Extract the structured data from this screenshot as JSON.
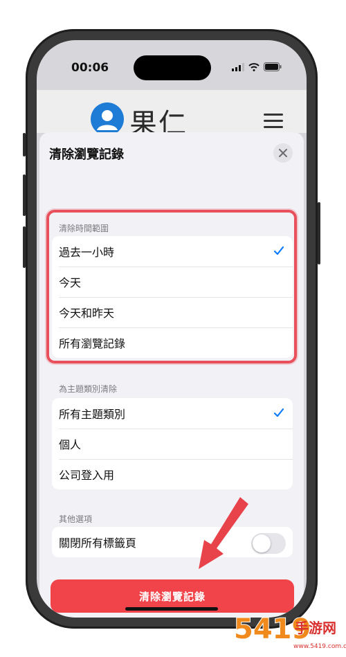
{
  "status_bar": {
    "time": "00:06"
  },
  "header": {
    "brand": "果仁"
  },
  "sheet": {
    "title": "清除瀏覽記錄",
    "time_range": {
      "header": "清除時間範圍",
      "options": [
        {
          "label": "過去一小時",
          "selected": true
        },
        {
          "label": "今天",
          "selected": false
        },
        {
          "label": "今天和昨天",
          "selected": false
        },
        {
          "label": "所有瀏覽記錄",
          "selected": false
        }
      ]
    },
    "profiles": {
      "header": "為主題類別清除",
      "options": [
        {
          "label": "所有主題類別",
          "selected": true
        },
        {
          "label": "個人",
          "selected": false
        },
        {
          "label": "公司登入用",
          "selected": false
        }
      ]
    },
    "other": {
      "header": "其他選項",
      "close_tabs_label": "關閉所有標籤頁",
      "close_tabs_on": false
    },
    "clear_button_label": "清除瀏覽記錄"
  },
  "watermark": {
    "text": "5419手游网",
    "subtext": "www.5419.com.cn"
  },
  "colors": {
    "accent_blue": "#0a7aff",
    "destructive_red": "#f1434a",
    "highlight_red": "#e8505b",
    "sheet_bg": "#f2f2f6"
  },
  "icons": [
    "signal-icon",
    "wifi-icon",
    "battery-icon",
    "close-icon",
    "checkmark-icon",
    "hamburger-icon",
    "avatar-icon",
    "arrow-icon"
  ]
}
